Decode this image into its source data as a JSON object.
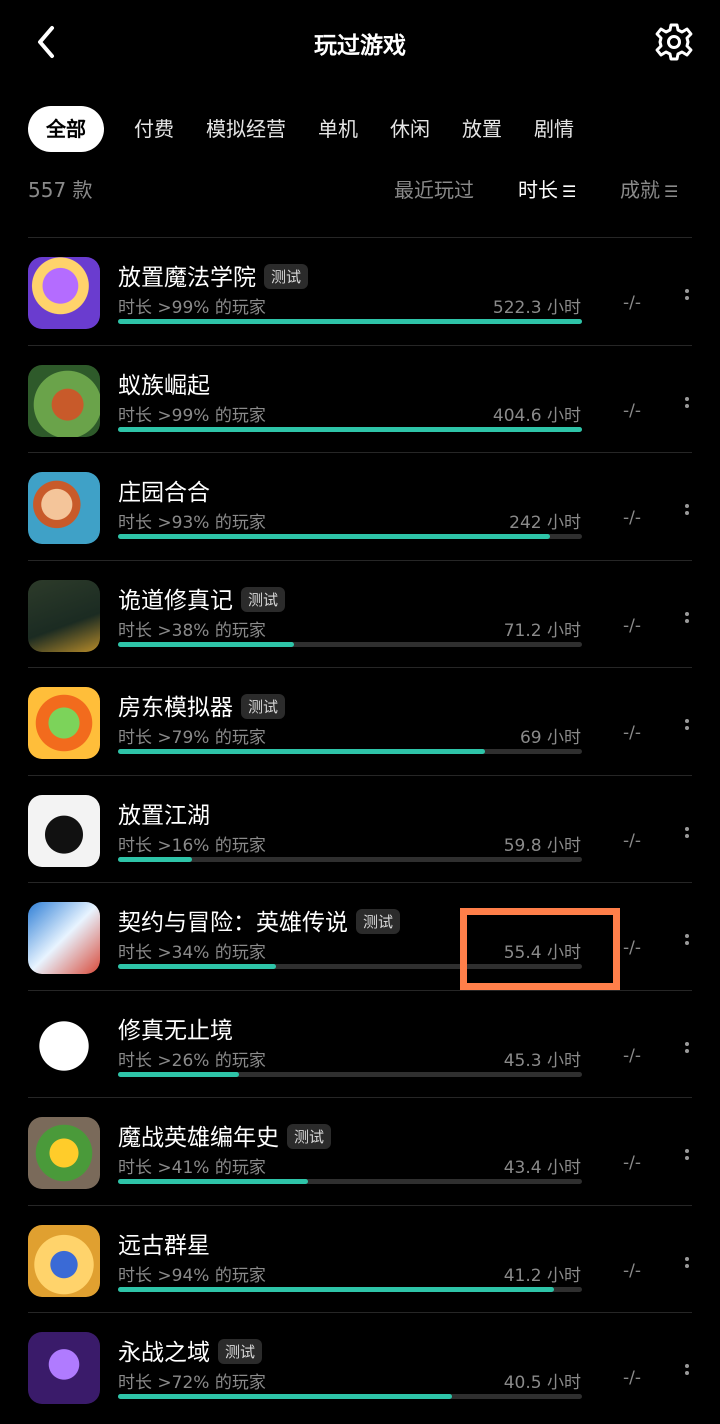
{
  "header": {
    "title": "玩过游戏",
    "back_icon": "chevron-left-icon",
    "settings_icon": "gear-icon"
  },
  "tabs": [
    {
      "label": "全部",
      "active": true
    },
    {
      "label": "付费"
    },
    {
      "label": "模拟经营"
    },
    {
      "label": "单机"
    },
    {
      "label": "休闲"
    },
    {
      "label": "放置"
    },
    {
      "label": "剧情"
    }
  ],
  "sort_bar": {
    "count": "557 款",
    "recent": "最近玩过",
    "duration": "时长",
    "achievement": "成就"
  },
  "colors": {
    "accent": "#2ec4a8",
    "highlight": "#ff7f4a"
  },
  "games": [
    {
      "name": "放置魔法学院",
      "tag": "测试",
      "percentile": "时长 >99% 的玩家",
      "hours": "522.3 小时",
      "progress": 1.0,
      "achievement": "-/-"
    },
    {
      "name": "蚁族崛起",
      "tag": "",
      "percentile": "时长 >99% 的玩家",
      "hours": "404.6 小时",
      "progress": 1.0,
      "achievement": "-/-"
    },
    {
      "name": "庄园合合",
      "tag": "",
      "percentile": "时长 >93% 的玩家",
      "hours": "242 小时",
      "progress": 0.93,
      "achievement": "-/-"
    },
    {
      "name": "诡道修真记",
      "tag": "测试",
      "percentile": "时长 >38% 的玩家",
      "hours": "71.2 小时",
      "progress": 0.38,
      "achievement": "-/-"
    },
    {
      "name": "房东模拟器",
      "tag": "测试",
      "percentile": "时长 >79% 的玩家",
      "hours": "69 小时",
      "progress": 0.79,
      "achievement": "-/-"
    },
    {
      "name": "放置江湖",
      "tag": "",
      "percentile": "时长 >16% 的玩家",
      "hours": "59.8 小时",
      "progress": 0.16,
      "achievement": "-/-"
    },
    {
      "name": "契约与冒险：英雄传说",
      "tag": "测试",
      "percentile": "时长 >34% 的玩家",
      "hours": "55.4 小时",
      "progress": 0.34,
      "achievement": "-/-"
    },
    {
      "name": "修真无止境",
      "tag": "",
      "percentile": "时长 >26% 的玩家",
      "hours": "45.3 小时",
      "progress": 0.26,
      "achievement": "-/-"
    },
    {
      "name": "魔战英雄编年史",
      "tag": "测试",
      "percentile": "时长 >41% 的玩家",
      "hours": "43.4 小时",
      "progress": 0.41,
      "achievement": "-/-"
    },
    {
      "name": "远古群星",
      "tag": "",
      "percentile": "时长 >94% 的玩家",
      "hours": "41.2 小时",
      "progress": 0.94,
      "achievement": "-/-"
    },
    {
      "name": "永战之域",
      "tag": "测试",
      "percentile": "时长 >72% 的玩家",
      "hours": "40.5 小时",
      "progress": 0.72,
      "achievement": "-/-"
    }
  ]
}
